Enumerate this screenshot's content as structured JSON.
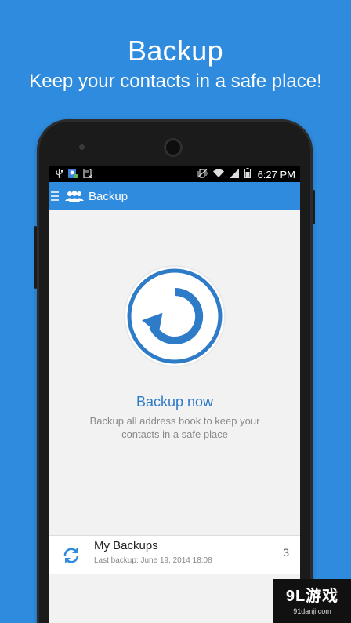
{
  "promo": {
    "title": "Backup",
    "subtitle": "Keep your contacts in a safe place!"
  },
  "statusbar": {
    "time": "6:27 PM",
    "icons": [
      "usb-icon",
      "app-notification-icon",
      "sd-card-icon",
      "vibrate-icon",
      "wifi-icon",
      "signal-icon",
      "battery-icon"
    ]
  },
  "appbar": {
    "title": "Backup",
    "icons": [
      "menu-icon",
      "contacts-icon"
    ]
  },
  "main": {
    "action_label": "Backup now",
    "description": "Backup all address book to keep your contacts in a safe place",
    "action_icon": "backup-restore-icon"
  },
  "backups": {
    "title": "My Backups",
    "subtitle": "Last backup: June 19, 2014 18:08",
    "count": "3",
    "icon": "sync-icon"
  },
  "watermark": {
    "logo": "9L游戏",
    "url": "91danji.com"
  },
  "colors": {
    "background": "#2e8bde",
    "accent": "#2e7bc7",
    "appbar": "#2e8bde"
  }
}
